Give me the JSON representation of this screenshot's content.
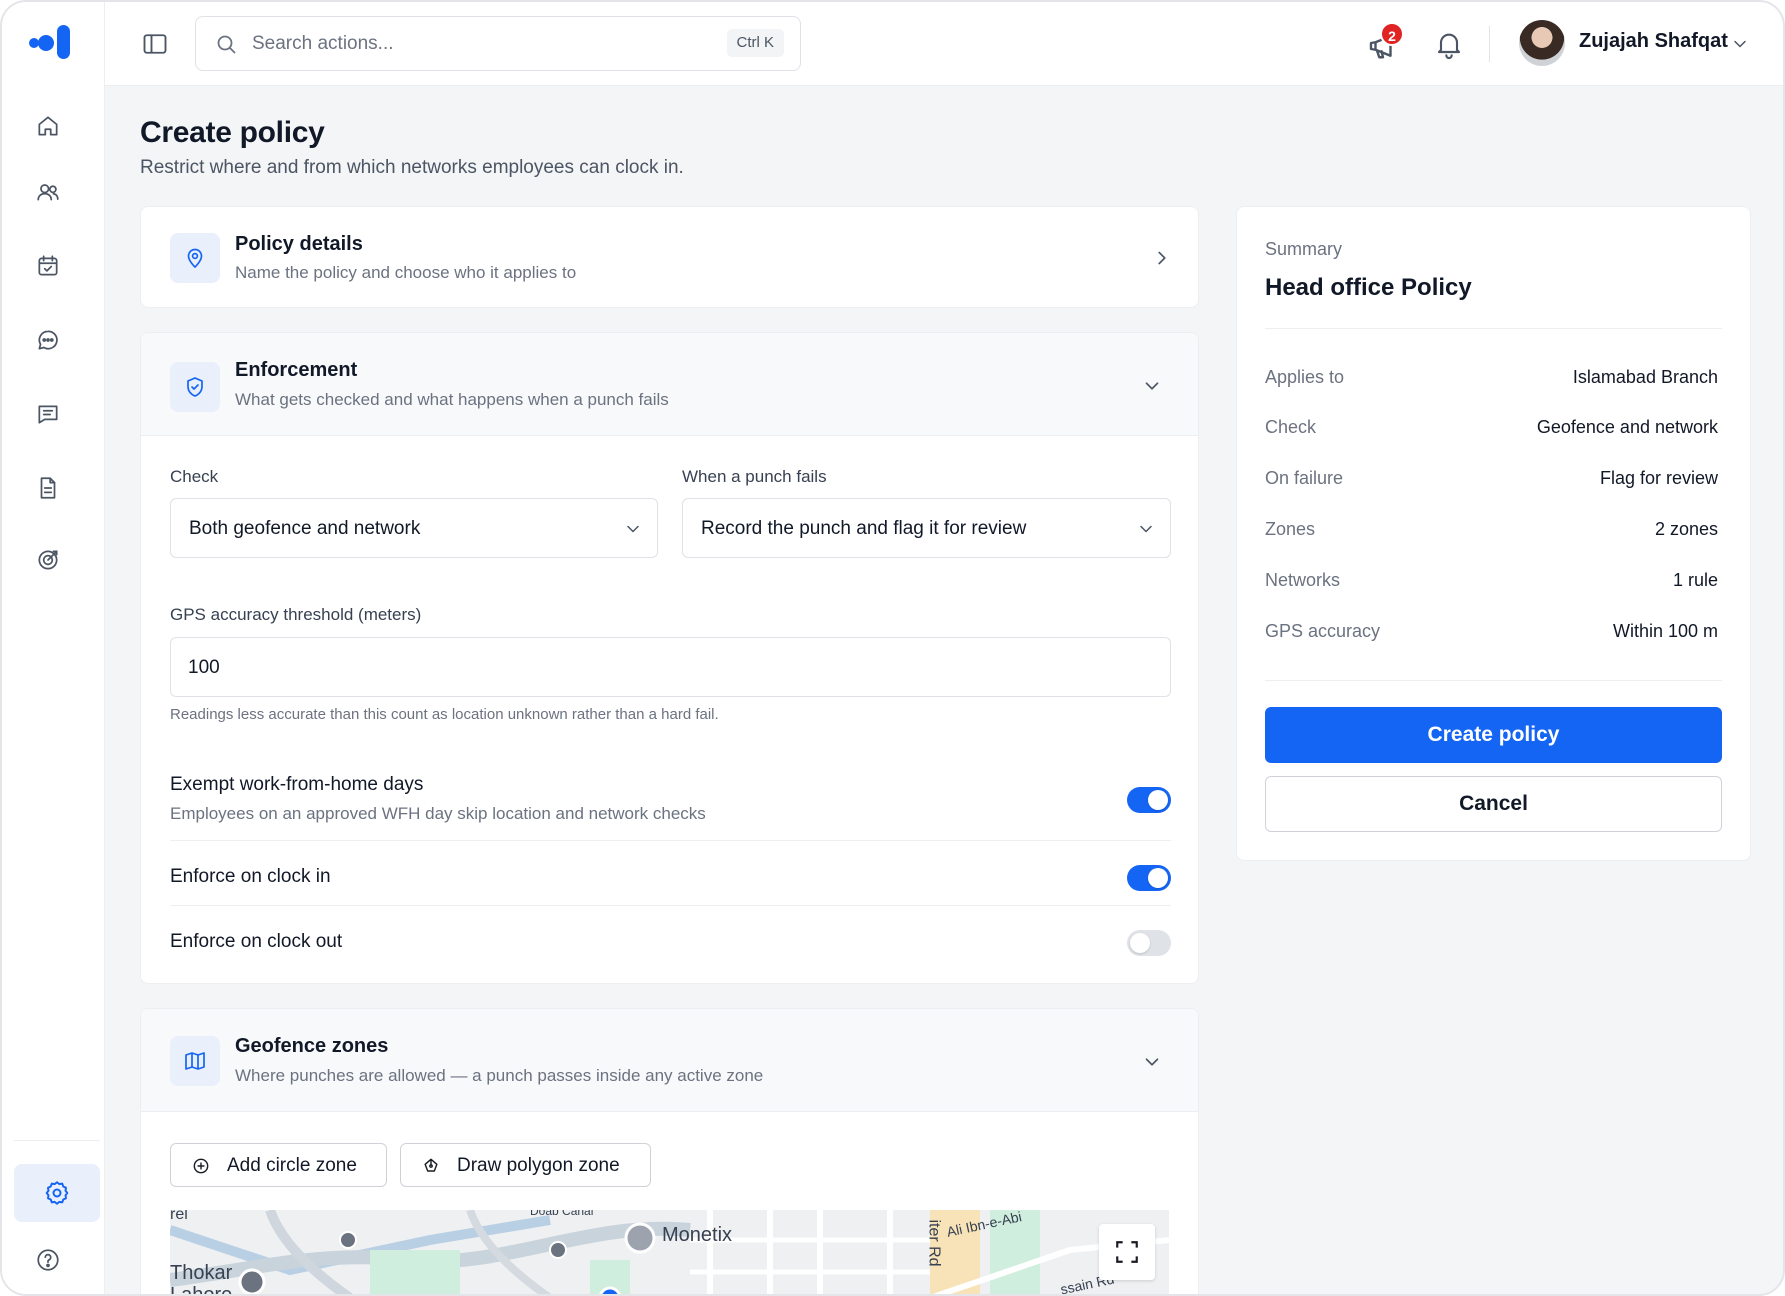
{
  "topbar": {
    "search_placeholder": "Search actions...",
    "search_shortcut": "Ctrl K",
    "notification_count": "2",
    "user_name": "Zujajah Shafqat"
  },
  "page": {
    "title": "Create policy",
    "subtitle": "Restrict where and from which networks employees can clock in."
  },
  "sections": {
    "policy_details": {
      "title": "Policy details",
      "description": "Name the policy and choose who it applies to"
    },
    "enforcement": {
      "title": "Enforcement",
      "description": "What gets checked and what happens when a punch fails",
      "check_label": "Check",
      "check_value": "Both geofence and network",
      "fail_label": "When a punch fails",
      "fail_value": "Record the punch and flag it for review",
      "gps_label": "GPS accuracy threshold (meters)",
      "gps_value": "100",
      "gps_helper": "Readings less accurate than this count as location unknown rather than a hard fail.",
      "toggles": [
        {
          "title": "Exempt work-from-home days",
          "description": "Employees on an approved WFH day skip location and network checks",
          "on": true
        },
        {
          "title": "Enforce on clock in",
          "on": true
        },
        {
          "title": "Enforce on clock out",
          "on": false
        }
      ]
    },
    "geofence": {
      "title": "Geofence zones",
      "description": "Where punches are allowed — a punch passes inside any active zone",
      "add_circle_label": "Add circle zone",
      "draw_polygon_label": "Draw polygon zone",
      "map_labels": {
        "place_1": "Monetix",
        "place_2": "Thokar",
        "place_3": "Lahore",
        "road_1": "Ali Ibn-e-Abi",
        "road_2": "iter Rd",
        "road_3": "ssain Rd",
        "road_4": "Doab Canal",
        "road_5": "rel"
      }
    }
  },
  "summary": {
    "label": "Summary",
    "policy_name": "Head office Policy",
    "rows": [
      {
        "label": "Applies to",
        "value": "Islamabad Branch"
      },
      {
        "label": "Check",
        "value": "Geofence and network"
      },
      {
        "label": "On failure",
        "value": "Flag for review"
      },
      {
        "label": "Zones",
        "value": "2 zones"
      },
      {
        "label": "Networks",
        "value": "1 rule"
      },
      {
        "label": "GPS accuracy",
        "value": "Within 100 m"
      }
    ],
    "create_label": "Create policy",
    "cancel_label": "Cancel"
  },
  "colors": {
    "accent": "#1565f5",
    "badge": "#e02424"
  },
  "icons": {
    "sidebar": [
      "home-icon",
      "users-icon",
      "calendar-check-icon",
      "chat-icon",
      "message-square-icon",
      "document-icon",
      "target-icon",
      "settings-icon",
      "help-icon"
    ]
  }
}
